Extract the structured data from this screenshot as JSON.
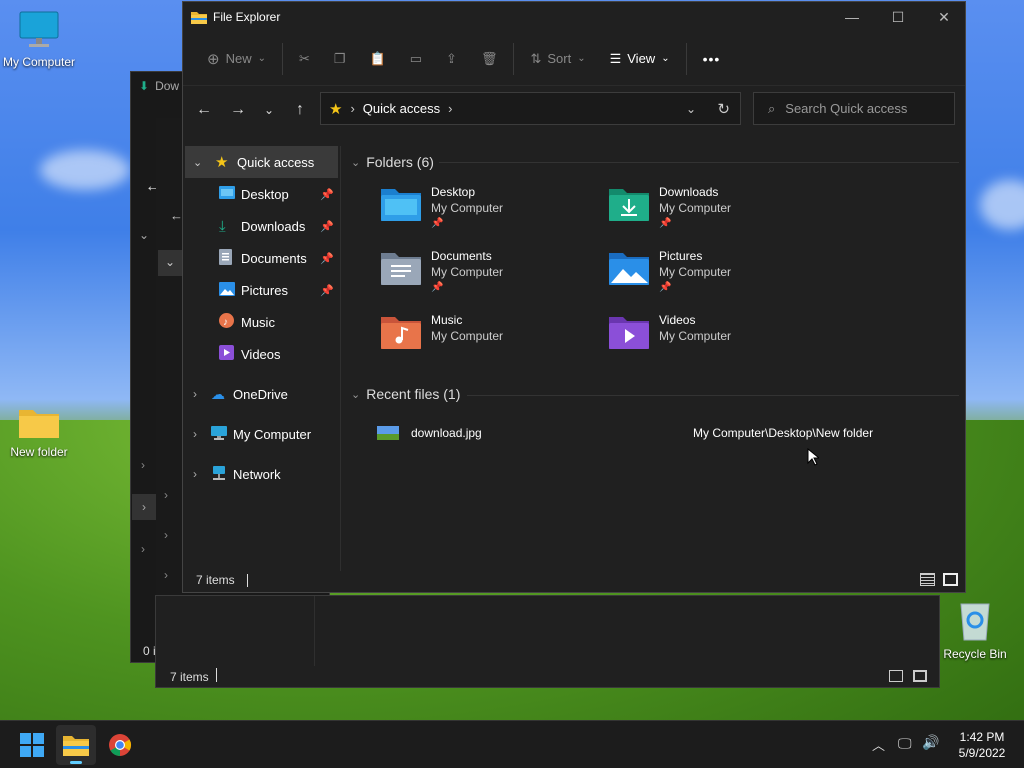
{
  "desktop": {
    "my_computer": "My Computer",
    "new_folder": "New folder",
    "recycle_bin": "Recycle Bin"
  },
  "back_window": {
    "title_partial": "Dow",
    "status_count": "7 items",
    "status_partial": "0 i"
  },
  "window": {
    "title": "File Explorer"
  },
  "toolbar": {
    "new": "New",
    "sort": "Sort",
    "view": "View",
    "more": "•••"
  },
  "address": {
    "location": "Quick access",
    "search_placeholder": "Search Quick access"
  },
  "sidebar": {
    "items": [
      {
        "label": "Quick access",
        "icon": "star-icon",
        "pinned": false
      },
      {
        "label": "Desktop",
        "icon": "desktop-folder-icon",
        "pinned": true
      },
      {
        "label": "Downloads",
        "icon": "download-icon",
        "pinned": true
      },
      {
        "label": "Documents",
        "icon": "document-icon",
        "pinned": true
      },
      {
        "label": "Pictures",
        "icon": "pictures-icon",
        "pinned": true
      },
      {
        "label": "Music",
        "icon": "music-icon",
        "pinned": false
      },
      {
        "label": "Videos",
        "icon": "video-icon",
        "pinned": false
      },
      {
        "label": "OneDrive",
        "icon": "cloud-icon",
        "pinned": false
      },
      {
        "label": "My Computer",
        "icon": "computer-icon",
        "pinned": false
      },
      {
        "label": "Network",
        "icon": "network-icon",
        "pinned": false
      }
    ]
  },
  "folders": {
    "heading": "Folders (6)",
    "items": [
      {
        "name": "Desktop",
        "location": "My Computer"
      },
      {
        "name": "Downloads",
        "location": "My Computer"
      },
      {
        "name": "Documents",
        "location": "My Computer"
      },
      {
        "name": "Pictures",
        "location": "My Computer"
      },
      {
        "name": "Music",
        "location": "My Computer"
      },
      {
        "name": "Videos",
        "location": "My Computer"
      }
    ]
  },
  "recent": {
    "heading": "Recent files (1)",
    "files": [
      {
        "name": "download.jpg",
        "path": "My Computer\\Desktop\\New folder"
      }
    ]
  },
  "status": {
    "count": "7 items"
  },
  "taskbar": {
    "time": "1:42 PM",
    "date": "5/9/2022"
  },
  "colors": {
    "accent_star": "#f5c518",
    "folder_blue": "#2f9ee8",
    "download_green": "#1fae8a",
    "pictures_blue": "#2a8fe8",
    "music_orange": "#e8744a",
    "videos_purple": "#8b4fd8"
  }
}
